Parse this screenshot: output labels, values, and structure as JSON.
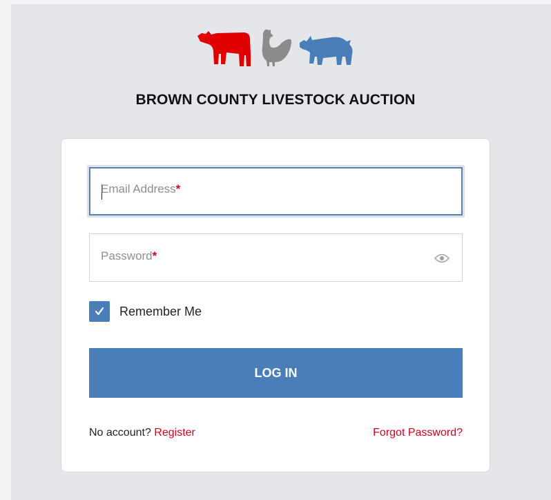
{
  "app": {
    "title": "BROWN COUNTY LIVESTOCK AUCTION"
  },
  "logo": {
    "icons": [
      "cow-icon",
      "chicken-icon",
      "pig-icon"
    ],
    "colors": {
      "cow": "#e10000",
      "chicken": "#8c8c8c",
      "pig": "#4a7eb8"
    }
  },
  "form": {
    "email": {
      "placeholder": "Email Address",
      "required_marker": "*",
      "value": ""
    },
    "password": {
      "placeholder": "Password",
      "required_marker": "*",
      "value": "",
      "toggle_icon": "eye-icon"
    },
    "remember_me": {
      "label": "Remember Me",
      "checked": true
    },
    "login_button_label": "LOG IN"
  },
  "footer": {
    "no_account_text": "No account?",
    "register_link": "Register",
    "forgot_password_link": "Forgot Password?"
  },
  "colors": {
    "accent": "#4a7eb8",
    "link": "#d0021b",
    "background": "#e4e6ea"
  }
}
